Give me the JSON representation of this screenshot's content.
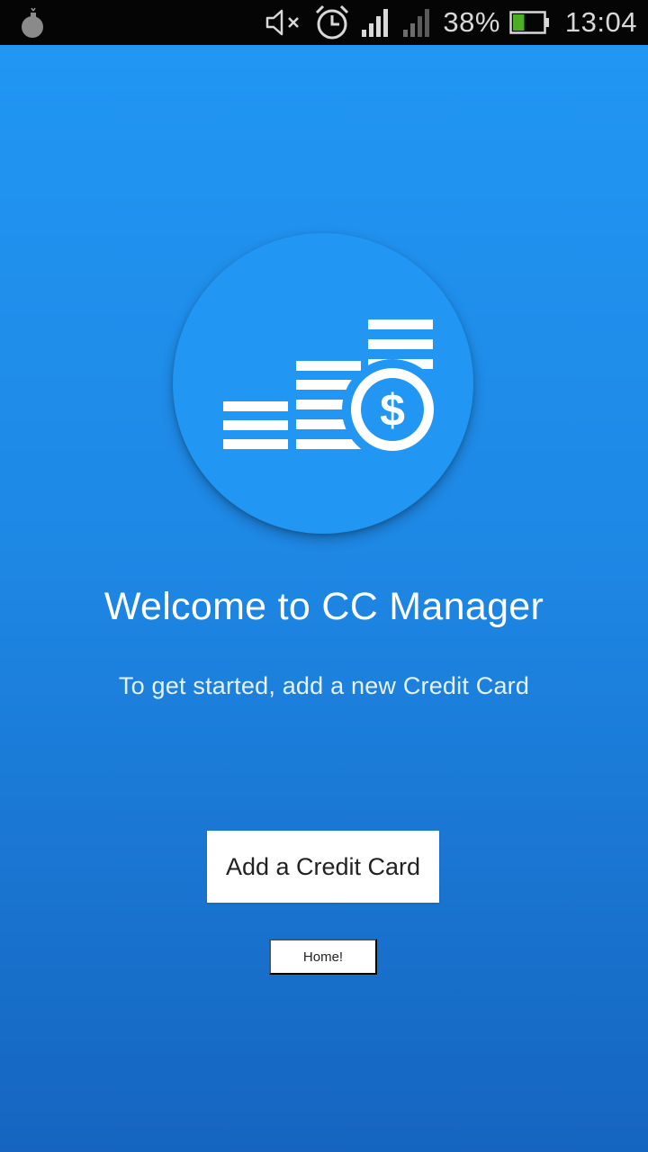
{
  "status_bar": {
    "left_icon": "notification-bomb-icon",
    "icons": [
      "mute-icon",
      "alarm-icon",
      "signal-icon",
      "signal-weak-icon",
      "battery-icon"
    ],
    "battery_percent": "38%",
    "battery_level": 0.38,
    "time": "13:04"
  },
  "welcome": {
    "logo_icon": "coins-dollar-icon",
    "title": "Welcome to CC Manager",
    "subtitle": "To get started, add a new Credit Card"
  },
  "actions": {
    "add_card_label": "Add a Credit Card",
    "home_label": "Home!"
  },
  "colors": {
    "background_top": "#2196f3",
    "background_bottom": "#1565c0",
    "logo_circle": "#2196f3",
    "status_bar": "#050505",
    "battery_fill": "#4caf22",
    "button": "#ffffff"
  }
}
